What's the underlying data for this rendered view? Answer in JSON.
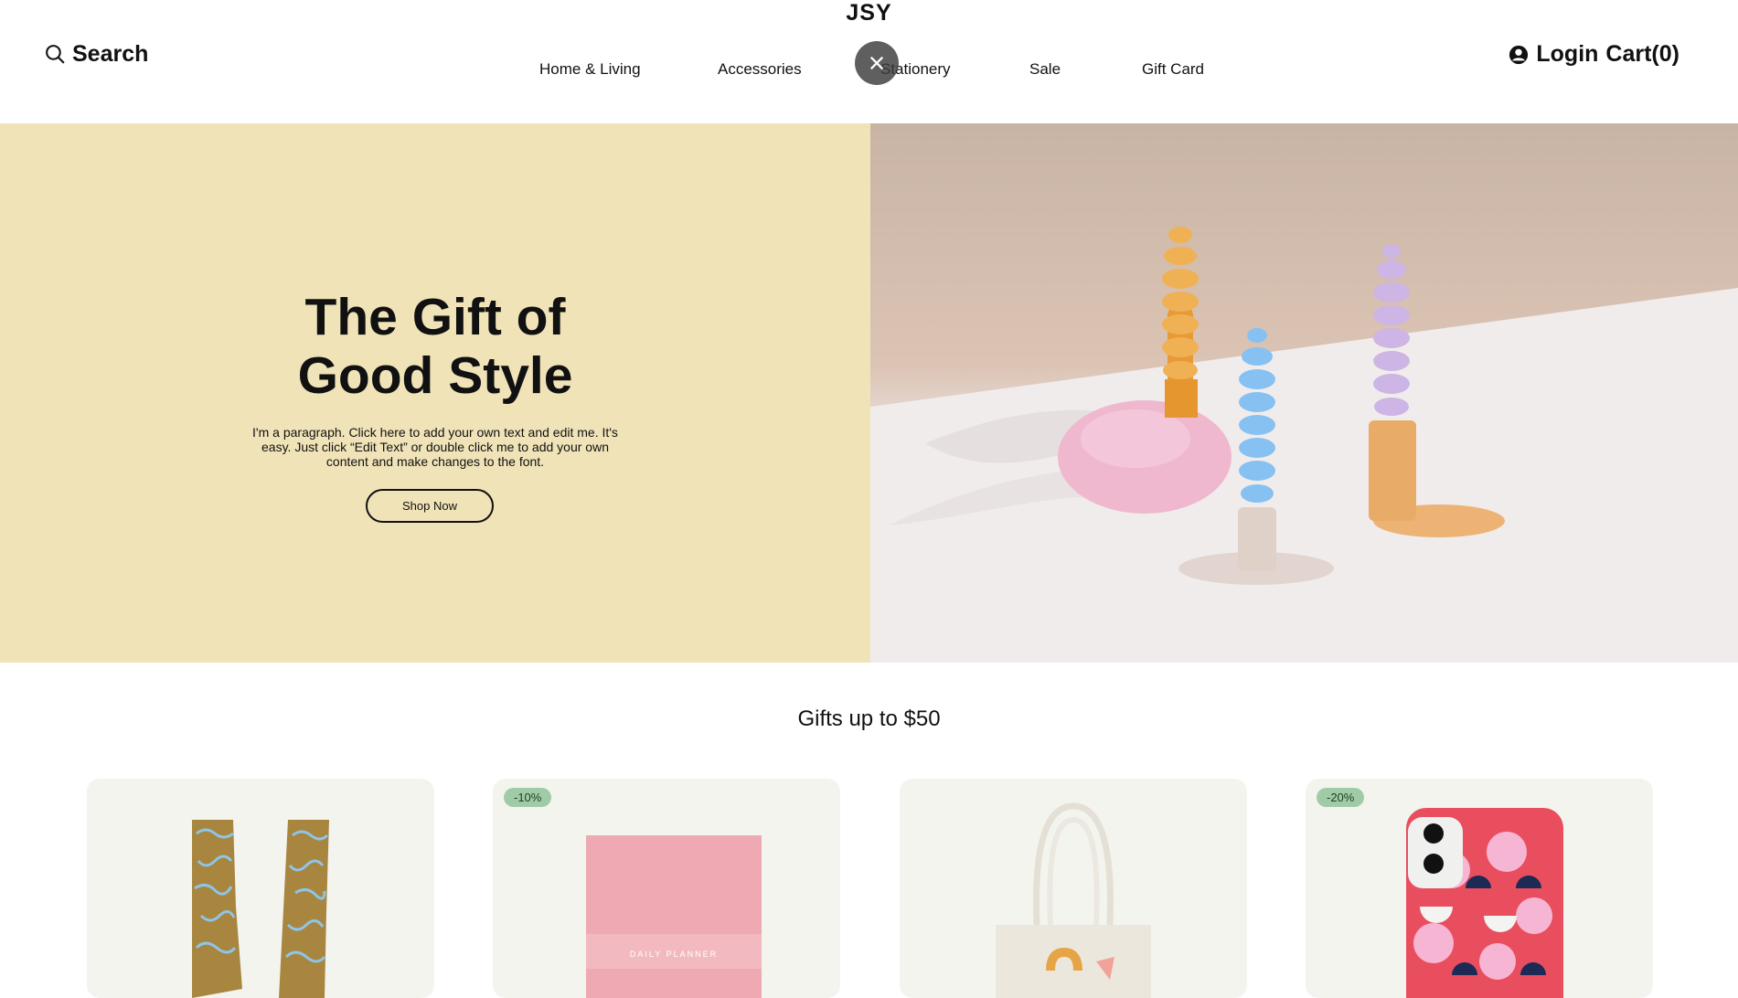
{
  "header": {
    "brand": "JSY",
    "search_label": "Search",
    "login_label": "Login",
    "cart_label": "Cart(0)",
    "nav": [
      "Home & Living",
      "Accessories",
      "Stationery",
      "Sale",
      "Gift Card"
    ]
  },
  "icons": {
    "search": "search-icon",
    "close": "close-icon",
    "account": "account-icon"
  },
  "hero": {
    "title_line1": "The Gift of",
    "title_line2": "Good Style",
    "paragraph": "I'm a paragraph. Click here to add your own text and edit me. It's easy. Just click “Edit Text” or double click me to add your own content and make changes to the font.",
    "button": "Shop Now"
  },
  "gifts": {
    "title": "Gifts up to $50",
    "products": [
      {
        "badge": ""
      },
      {
        "badge": "-10%",
        "cover_text": "DAILY PLANNER"
      },
      {
        "badge": ""
      },
      {
        "badge": "-20%"
      }
    ]
  },
  "colors": {
    "hero_bg": "#f0e3b8",
    "badge_bg": "#9fcca6",
    "card_bg": "#f4f4ef"
  }
}
